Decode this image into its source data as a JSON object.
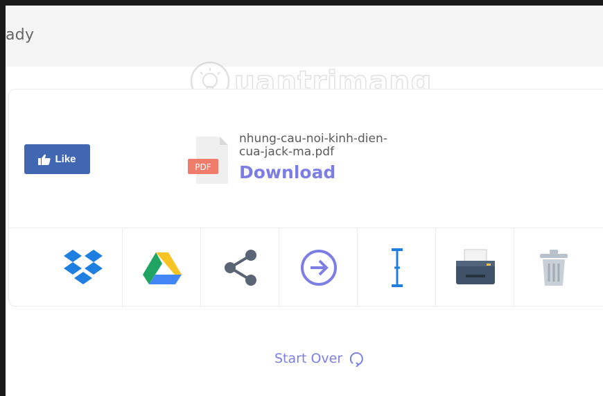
{
  "header": {
    "title": "ady"
  },
  "watermark": {
    "text": "uantrimang"
  },
  "like_button": {
    "label": "Like"
  },
  "file": {
    "badge": "PDF",
    "name": "nhung-cau-noi-kinh-dien-cua-jack-ma.pdf",
    "name_line1": "nhung-cau-noi-kinh-dien-",
    "name_line2": "cua-jack-ma.pdf",
    "download_label": "Download"
  },
  "toolbar": {
    "items": [
      {
        "icon": "dropbox-icon"
      },
      {
        "icon": "google-drive-icon"
      },
      {
        "icon": "share-icon"
      },
      {
        "icon": "arrow-right-circle-icon"
      },
      {
        "icon": "text-cursor-icon"
      },
      {
        "icon": "printer-icon"
      },
      {
        "icon": "trash-icon"
      }
    ]
  },
  "start_over": {
    "label": "Start Over"
  },
  "colors": {
    "accent": "#7c7ee3",
    "facebook": "#4267b2",
    "pdf_badge": "#f07c6c",
    "dropbox": "#1f7fe0",
    "cursor_blue": "#1f7fe0"
  }
}
